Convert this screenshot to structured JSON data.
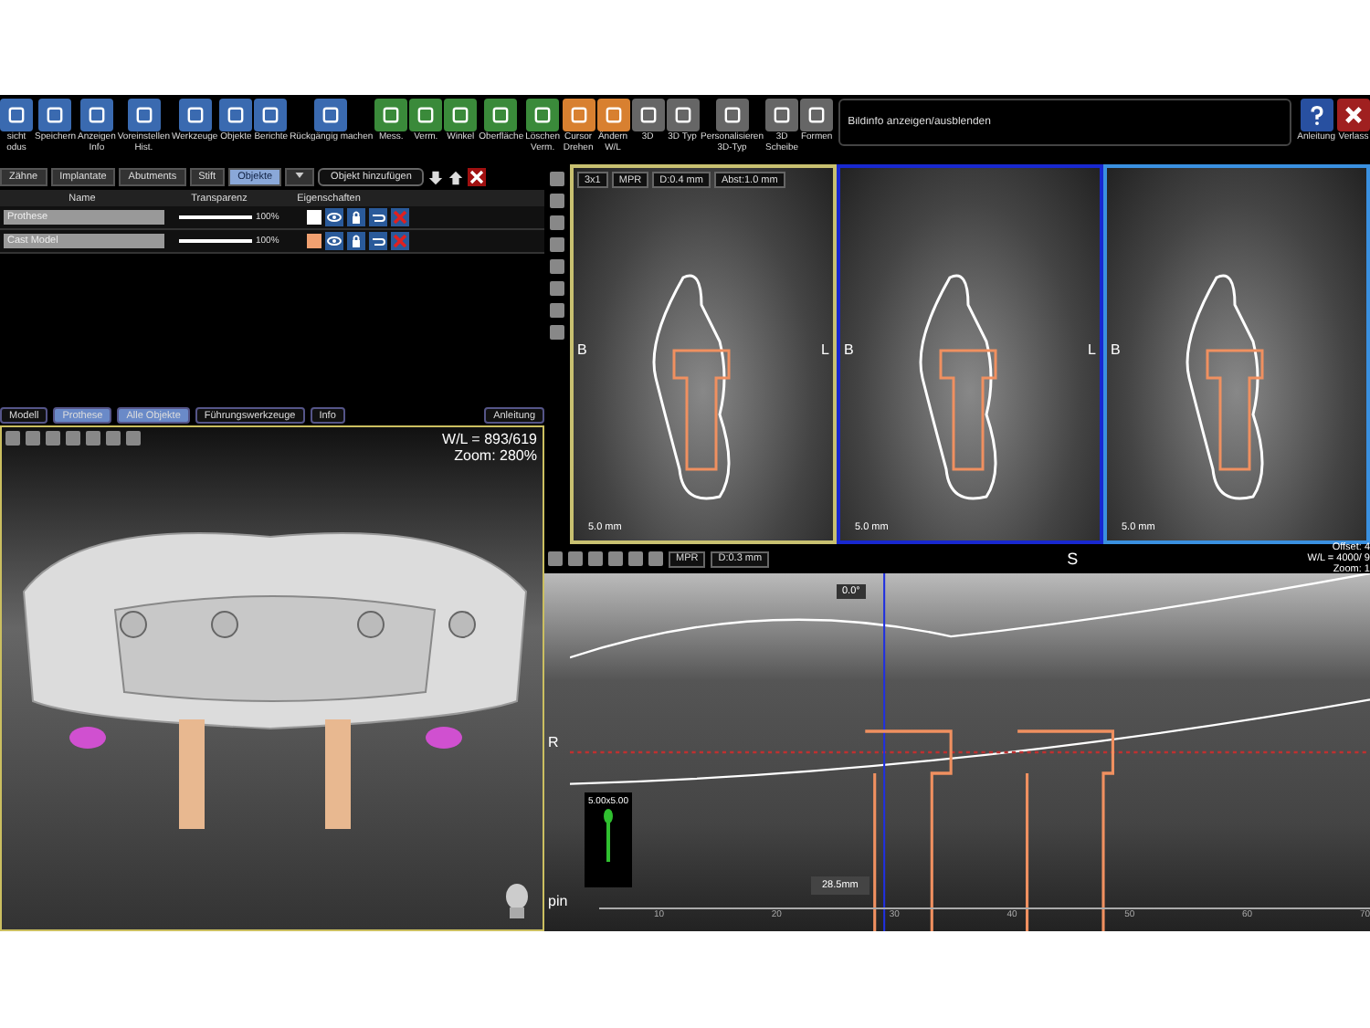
{
  "toolbar": {
    "items": [
      {
        "label": "sicht\nodus",
        "kind": "file"
      },
      {
        "label": "Speichern",
        "kind": "file"
      },
      {
        "label": "Anzeigen\nInfo",
        "kind": "file"
      },
      {
        "label": "Voreinstellen\nHist.",
        "kind": "file"
      },
      {
        "label": "Werkzeuge",
        "kind": "file"
      },
      {
        "label": "Objekte",
        "kind": "file"
      },
      {
        "label": "Berichte",
        "kind": "file"
      },
      {
        "label": "Rückgängig machen",
        "kind": "file"
      },
      {
        "label": "Mess.",
        "kind": "measure"
      },
      {
        "label": "Verm.",
        "kind": "measure"
      },
      {
        "label": "Winkel",
        "kind": "measure"
      },
      {
        "label": "Oberfläche",
        "kind": "measure"
      },
      {
        "label": "Löschen\nVerm.",
        "kind": "measure"
      },
      {
        "label": "Cursor\nDrehen",
        "kind": "cursor"
      },
      {
        "label": "Ändern\nW/L",
        "kind": "cursor"
      },
      {
        "label": "3D",
        "kind": "plain"
      },
      {
        "label": "3D Typ",
        "kind": "plain"
      },
      {
        "label": "Personalisieren\n3D-Typ",
        "kind": "plain"
      },
      {
        "label": "3D\nScheibe",
        "kind": "plain"
      },
      {
        "label": "Formen",
        "kind": "plain"
      }
    ],
    "info_field": {
      "value": "Bildinfo anzeigen/ausblenden"
    },
    "right_items": [
      {
        "label": "Anleitung",
        "kind": "help"
      },
      {
        "label": "Verlass",
        "kind": "exit"
      }
    ]
  },
  "object_panel": {
    "tabs": [
      {
        "label": "Zähne",
        "selected": false
      },
      {
        "label": "Implantate",
        "selected": false
      },
      {
        "label": "Abutments",
        "selected": false
      },
      {
        "label": "Stift",
        "selected": false
      },
      {
        "label": "Objekte",
        "selected": true
      }
    ],
    "add_button": "Objekt hinzufügen",
    "columns": [
      "Name",
      "Transparenz",
      "Eigenschaften"
    ],
    "rows": [
      {
        "name": "Prothese",
        "level": 1,
        "reading": "100%",
        "color": "#ffffff"
      },
      {
        "name": "Cast Model",
        "level": 1,
        "reading": "100%",
        "color": "#f0a070"
      }
    ]
  },
  "view_tabs": [
    {
      "label": "Modell",
      "selected": false
    },
    {
      "label": "Prothese",
      "selected": true
    },
    {
      "label": "Alle Objekte",
      "selected": true
    },
    {
      "label": "Führungswerkzeuge",
      "selected": false
    },
    {
      "label": "Info",
      "selected": false
    }
  ],
  "view_help": "Anleitung",
  "view_3d": {
    "wl": "W/L = 893/619",
    "zoom": "Zoom: 280%"
  },
  "slices": {
    "buttons": [
      "3x1",
      "MPR",
      "D:0.4 mm",
      "Abst:1.0 mm"
    ],
    "views": [
      {
        "left_label": "B",
        "right_label": "L",
        "scale": "5.0 mm",
        "color": "#c8c070"
      },
      {
        "left_label": "B",
        "right_label": "L",
        "scale": "5.0 mm",
        "color": "#1828d0"
      },
      {
        "left_label": "B",
        "scale": "5.0 mm",
        "color": "#3a90e0"
      }
    ]
  },
  "pano": {
    "buttons": [
      "MPR",
      "D:0.3 mm"
    ],
    "top_label": "S",
    "info": [
      "Offset: 4",
      "W/L = 4000/ 9",
      "Zoom: 1"
    ],
    "side_label": "R",
    "angle": "0.0°",
    "distance": "28.5mm",
    "legend": "5.00x5.00",
    "corner_label": "pin",
    "ticks": [
      "10",
      "20",
      "30",
      "40",
      "50",
      "60",
      "70"
    ]
  }
}
